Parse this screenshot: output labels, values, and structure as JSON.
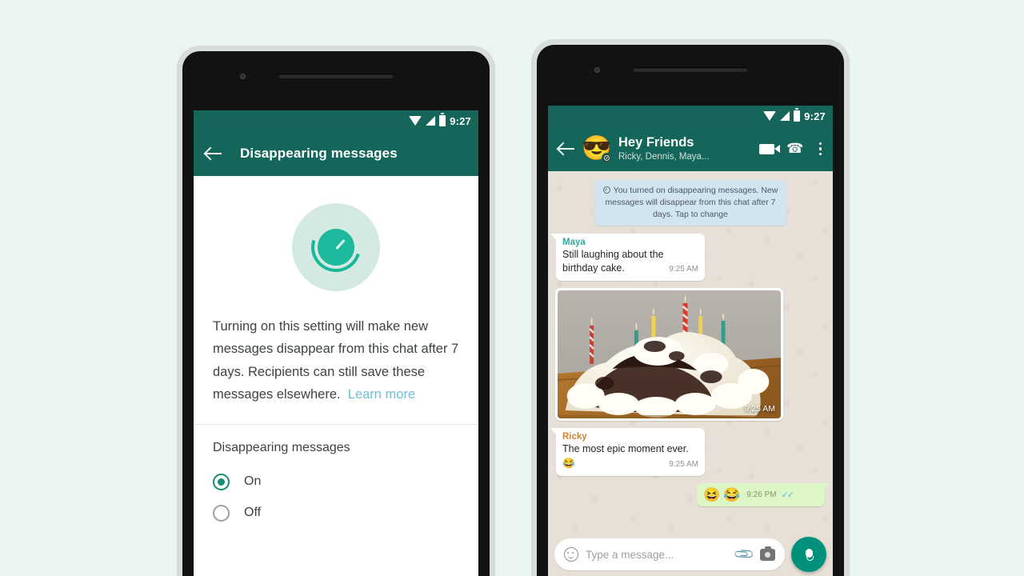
{
  "background_color": "#eaf5f1",
  "theme": {
    "header_green": "#14665a",
    "accent_teal": "#168c73",
    "chat_wallpaper": "#e7e0d7",
    "outgoing_bubble": "#dcf7c5",
    "system_bubble": "#d2e4f0",
    "link_blue": "#6fc0d6"
  },
  "left_phone": {
    "status_bar": {
      "time": "9:27",
      "icons": [
        "wifi-icon",
        "signal-icon",
        "battery-icon"
      ]
    },
    "app_bar": {
      "back_icon": "back-arrow-icon",
      "title": "Disappearing messages"
    },
    "hero": {
      "icon": "disappearing-timer-icon"
    },
    "description": {
      "text": "Turning on this setting will make new messages disappear from this chat after 7 days. Recipients can still save these messages elsewhere.",
      "link_label": "Learn more"
    },
    "section": {
      "title": "Disappearing messages",
      "options": [
        {
          "label": "On",
          "selected": true
        },
        {
          "label": "Off",
          "selected": false
        }
      ]
    }
  },
  "right_phone": {
    "status_bar": {
      "time": "9:27",
      "icons": [
        "wifi-icon",
        "signal-icon",
        "battery-icon"
      ]
    },
    "app_bar": {
      "back_icon": "back-arrow-icon",
      "avatar_emoji": "😎",
      "avatar_badge": "timer-badge-icon",
      "name": "Hey Friends",
      "subtitle": "Ricky, Dennis, Maya...",
      "actions": [
        "video-call-icon",
        "voice-call-icon",
        "overflow-menu-icon"
      ]
    },
    "system_message": "You turned on disappearing messages. New messages will disappear from this chat after 7 days. Tap to change",
    "messages": [
      {
        "type": "incoming-text",
        "sender": "Maya",
        "sender_color": "#34a6a0",
        "text": "Still laughing about the birthday cake.",
        "time": "9:25 AM"
      },
      {
        "type": "incoming-image",
        "caption_alt": "birthday cake with candles",
        "time": "9:25 AM"
      },
      {
        "type": "incoming-text",
        "sender": "Ricky",
        "sender_color": "#c8863a",
        "text": "The most epic moment ever.",
        "emoji": "😂",
        "time": "9:25 AM"
      },
      {
        "type": "outgoing",
        "emojis": [
          "😆",
          "😂"
        ],
        "time": "9:26 PM",
        "status": "read"
      }
    ],
    "input_bar": {
      "emoji_icon": "smiley-icon",
      "placeholder": "Type a message...",
      "attach_icon": "paperclip-icon",
      "camera_icon": "camera-icon",
      "mic_icon": "microphone-icon"
    }
  }
}
